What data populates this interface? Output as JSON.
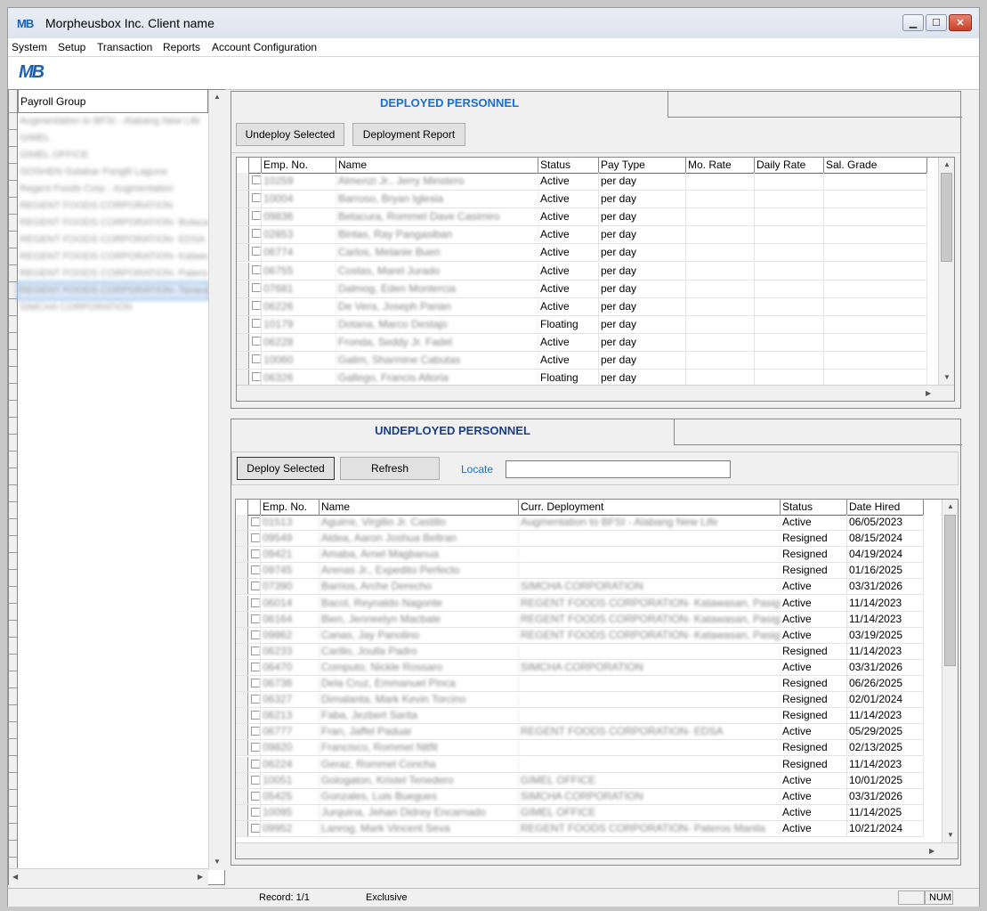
{
  "window": {
    "title": "Morpheusbox Inc. Client name",
    "logo_text": "MB",
    "controls": {
      "minimize": "▁",
      "maximize": "☐",
      "close": "✕"
    }
  },
  "menu": [
    "System",
    "Setup",
    "Transaction",
    "Reports",
    "Account Configuration"
  ],
  "left_panel": {
    "header": "Payroll Group",
    "items": [
      "Augmentation to BFSI - Alabang New Life",
      "GIMEL",
      "GIMEL OFFICE",
      "GOSHEN Galabar Panglil Laguna",
      "Regent Foods Corp - Augmentation",
      "REGENT FOODS CORPORATION",
      "REGENT FOODS CORPORATION- Bulacan",
      "REGENT FOODS CORPORATION- EDSA",
      "REGENT FOODS CORPORATION- Katawasan",
      "REGENT FOODS CORPORATION- Pateros",
      "REGENT FOODS CORPORATION- Tanauan",
      "SIMCHA CORPORATION"
    ],
    "selected_index": 10
  },
  "deployed": {
    "tab_label": "DEPLOYED PERSONNEL",
    "buttons": {
      "undeploy": "Undeploy Selected",
      "report": "Deployment Report"
    },
    "columns": [
      "Emp. No.",
      "Name",
      "Status",
      "Pay Type",
      "Mo. Rate",
      "Daily Rate",
      "Sal. Grade"
    ],
    "rows": [
      [
        "10259",
        "Almenzi Jr., Jerry Minstero",
        "Active",
        "per day"
      ],
      [
        "10004",
        "Barroso, Bryan Iglesia",
        "Active",
        "per day"
      ],
      [
        "09836",
        "Betacura, Rommel Dave Casimiro",
        "Active",
        "per day"
      ],
      [
        "02853",
        "Bintas, Ray Pangasiban",
        "Active",
        "per day"
      ],
      [
        "06774",
        "Carlos, Melanie Buen",
        "Active",
        "per day"
      ],
      [
        "06755",
        "Costas, Marel Jurado",
        "Active",
        "per day"
      ],
      [
        "07681",
        "Dalmog, Eden Montercia",
        "Active",
        "per day"
      ],
      [
        "06226",
        "De Vera, Joseph Parian",
        "Active",
        "per day"
      ],
      [
        "10179",
        "Dotana, Marco Destajo",
        "Floating",
        "per day"
      ],
      [
        "06228",
        "Fronda, Seddy Jr. Fadel",
        "Active",
        "per day"
      ],
      [
        "10060",
        "Galim, Sharmine Cabutas",
        "Active",
        "per day"
      ],
      [
        "06326",
        "Gallego, Francis Altoria",
        "Floating",
        "per day"
      ]
    ]
  },
  "undeployed": {
    "tab_label": "UNDEPLOYED PERSONNEL",
    "buttons": {
      "deploy": "Deploy Selected",
      "refresh": "Refresh"
    },
    "locate_label": "Locate",
    "locate_value": "",
    "columns": [
      "Emp. No.",
      "Name",
      "Curr. Deployment",
      "Status",
      "Date Hired"
    ],
    "rows": [
      [
        "01513",
        "Aguirre, Virgilio Jr. Castillo",
        "Augmentation to BFSI - Alabang New Life",
        "Active",
        "06/05/2023"
      ],
      [
        "09549",
        "Aldea, Aaron Joshua Beltran",
        "",
        "Resigned",
        "08/15/2024"
      ],
      [
        "09421",
        "Amaba, Arnel Magbanua",
        "",
        "Resigned",
        "04/19/2024"
      ],
      [
        "09745",
        "Arenas Jr., Expedito Perfecto",
        "",
        "Resigned",
        "01/16/2025"
      ],
      [
        "07390",
        "Barrios, Arche Derecho",
        "SIMCHA CORPORATION",
        "Active",
        "03/31/2026"
      ],
      [
        "06014",
        "Bacol, Reynaldo Nagonte",
        "REGENT FOODS CORPORATION- Katawasan, Pasig",
        "Active",
        "11/14/2023"
      ],
      [
        "06164",
        "Bien, Jenneelyn Macbale",
        "REGENT FOODS CORPORATION- Katawasan, Pasig",
        "Active",
        "11/14/2023"
      ],
      [
        "09862",
        "Canas, Jay Panolino",
        "REGENT FOODS CORPORATION- Katawasan, Pasig",
        "Active",
        "03/19/2025"
      ],
      [
        "06233",
        "Carillo, Joulla Padro",
        "",
        "Resigned",
        "11/14/2023"
      ],
      [
        "06470",
        "Computo, Nickle Rossaro",
        "SIMCHA CORPORATION",
        "Active",
        "03/31/2026"
      ],
      [
        "06736",
        "Dela Cruz, Emmanuel Pinca",
        "",
        "Resigned",
        "06/26/2025"
      ],
      [
        "06327",
        "Dimalanta, Mark Kevin Torcino",
        "",
        "Resigned",
        "02/01/2024"
      ],
      [
        "06213",
        "Faba, Jezbert Sarita",
        "",
        "Resigned",
        "11/14/2023"
      ],
      [
        "06777",
        "Fran, Jaffel Paduar",
        "REGENT FOODS CORPORATION- EDSA",
        "Active",
        "05/29/2025"
      ],
      [
        "09820",
        "Francisco, Rommel Nitfit",
        "",
        "Resigned",
        "02/13/2025"
      ],
      [
        "06224",
        "Geraz, Rommel Concha",
        "",
        "Resigned",
        "11/14/2023"
      ],
      [
        "10051",
        "Gologaton, Kristel Tenedero",
        "GIMEL OFFICE",
        "Active",
        "10/01/2025"
      ],
      [
        "05425",
        "Gonzales, Luis Buegues",
        "SIMCHA CORPORATION",
        "Active",
        "03/31/2026"
      ],
      [
        "10095",
        "Jurquina, Jehan Didrey Encarnado",
        "GIMEL OFFICE",
        "Active",
        "11/14/2025"
      ],
      [
        "09952",
        "Lanrog, Mark Vincent Seva",
        "REGENT FOODS CORPORATION- Pateros Manila",
        "Active",
        "10/21/2024"
      ]
    ]
  },
  "statusbar": {
    "record": "Record: 1/1",
    "mode": "Exclusive",
    "num": "NUM"
  }
}
